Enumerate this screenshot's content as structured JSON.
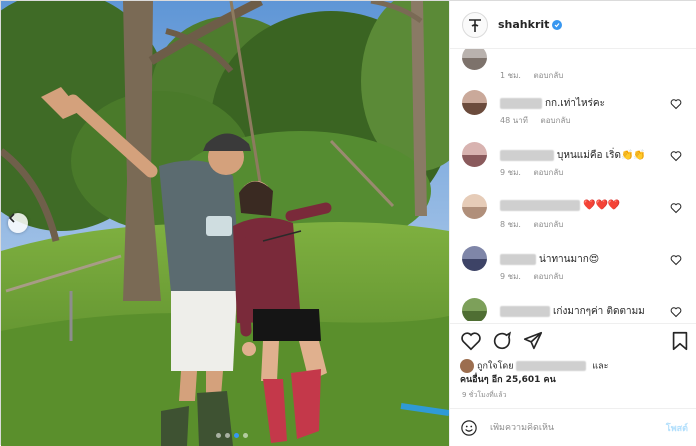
{
  "post": {
    "username": "shahkrit",
    "verified_icon": "verified-badge-icon",
    "photo_description_icon": "post-photo"
  },
  "comments": [
    {
      "text": "",
      "emoji": "",
      "time": "1 ชม.",
      "reply": "ตอบกลับ",
      "avatar_colors": [
        "#b9b2ae",
        "#7d726b"
      ]
    },
    {
      "text": "กก.เท่าไหร่คะ",
      "emoji": "",
      "time": "48 นาที",
      "reply": "ตอบกลับ",
      "avatar_colors": [
        "#caa99a",
        "#6b4b3c"
      ]
    },
    {
      "text": "บุหนแม่คือ เริ่ด",
      "emoji": "👏👏",
      "time": "9 ชม.",
      "reply": "ตอบกลับ",
      "avatar_colors": [
        "#d8b3b0",
        "#8a5a5c"
      ]
    },
    {
      "text": "",
      "emoji": "❤️❤️❤️",
      "time": "8 ชม.",
      "reply": "ตอบกลับ",
      "avatar_colors": [
        "#e6ccb8",
        "#b08f7a"
      ]
    },
    {
      "text": "น่าทานมาก",
      "emoji": "😍",
      "time": "9 ชม.",
      "reply": "ตอบกลับ",
      "avatar_colors": [
        "#7f86a8",
        "#3d4366"
      ]
    },
    {
      "text": "เก่งมากๆค่า ติดตามม",
      "emoji": "",
      "time": "",
      "reply": "",
      "avatar_colors": [
        "#7da05a",
        "#4f6e33"
      ]
    }
  ],
  "likes": {
    "prefix": "ถูกใจโดย",
    "and": "และ",
    "others": "คนอื่นๆ อีก 25,601 คน"
  },
  "timestamp": "9 ชั่วโมงที่แล้ว",
  "add_comment": {
    "placeholder": "เพิ่มความคิดเห็น",
    "post_label": "โพสต์"
  },
  "colors": {
    "accent": "#3897f0",
    "post_disabled": "#b2dffc",
    "heart_red": "#ed4956",
    "muted": "#8e8e8e"
  }
}
